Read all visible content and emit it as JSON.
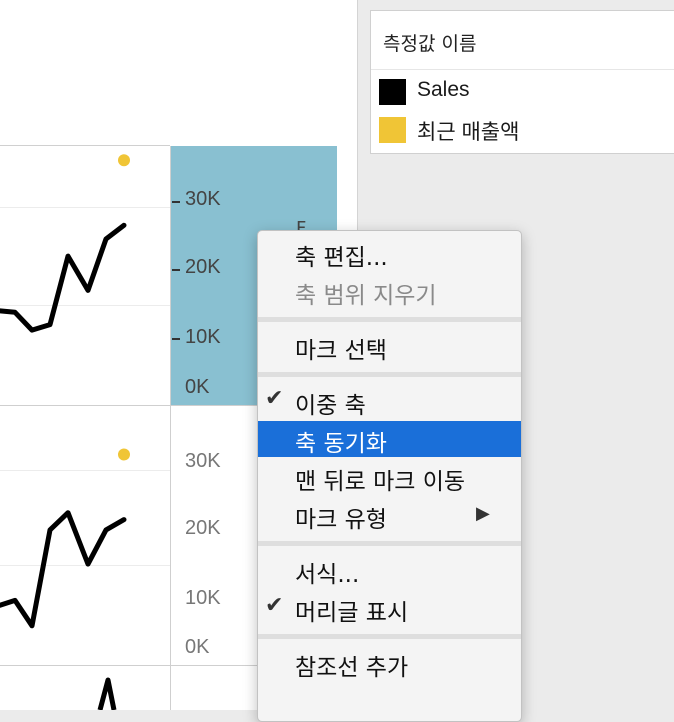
{
  "legend": {
    "title": "측정값 이름",
    "items": [
      {
        "label": "Sales",
        "color": "#000000"
      },
      {
        "label": "최근 매출액",
        "color": "#f0c536"
      }
    ]
  },
  "axis_top": {
    "ticks": [
      "30K",
      "20K",
      "10K",
      "0K"
    ]
  },
  "axis_bottom": {
    "ticks": [
      "30K",
      "20K",
      "10K",
      "0K"
    ]
  },
  "partial_text": "F",
  "colors": {
    "highlight": "#1a6fd9",
    "axis_selected": "#89c0d1",
    "latest_sales": "#f0c536",
    "sales_line": "#000000"
  },
  "chart_data": [
    {
      "type": "line",
      "ylim": [
        0,
        35000
      ],
      "yticks": [
        "0K",
        "10K",
        "20K",
        "30K"
      ],
      "series": [
        {
          "name": "Sales",
          "values": [
            13000,
            12800,
            10200,
            11000,
            21000,
            16000,
            23500,
            25500
          ]
        },
        {
          "name": "최근 매출액",
          "values": [
            null,
            null,
            null,
            null,
            null,
            null,
            null,
            35000
          ]
        }
      ]
    },
    {
      "type": "line",
      "ylim": [
        0,
        35000
      ],
      "yticks": [
        "0K",
        "10K",
        "20K",
        "30K"
      ],
      "series": [
        {
          "name": "Sales",
          "values": [
            8000,
            8700,
            5000,
            19000,
            21500,
            14000,
            19000,
            20500
          ]
        },
        {
          "name": "최근 매출액",
          "values": [
            null,
            null,
            null,
            null,
            null,
            null,
            null,
            30000
          ]
        }
      ]
    }
  ],
  "context_menu": {
    "groups": [
      [
        {
          "label": "축 편집...",
          "checked": false,
          "disabled": false,
          "highlighted": false,
          "submenu": false
        },
        {
          "label": "축 범위 지우기",
          "checked": false,
          "disabled": true,
          "highlighted": false,
          "submenu": false
        }
      ],
      [
        {
          "label": "마크 선택",
          "checked": false,
          "disabled": false,
          "highlighted": false,
          "submenu": false
        }
      ],
      [
        {
          "label": "이중 축",
          "checked": true,
          "disabled": false,
          "highlighted": false,
          "submenu": false
        },
        {
          "label": "축 동기화",
          "checked": false,
          "disabled": false,
          "highlighted": true,
          "submenu": false
        },
        {
          "label": "맨 뒤로 마크 이동",
          "checked": false,
          "disabled": false,
          "highlighted": false,
          "submenu": false
        },
        {
          "label": "마크 유형",
          "checked": false,
          "disabled": false,
          "highlighted": false,
          "submenu": true
        }
      ],
      [
        {
          "label": "서식...",
          "checked": false,
          "disabled": false,
          "highlighted": false,
          "submenu": false
        },
        {
          "label": "머리글 표시",
          "checked": true,
          "disabled": false,
          "highlighted": false,
          "submenu": false
        }
      ],
      [
        {
          "label": "참조선 추가",
          "checked": false,
          "disabled": false,
          "highlighted": false,
          "submenu": false
        }
      ]
    ]
  }
}
